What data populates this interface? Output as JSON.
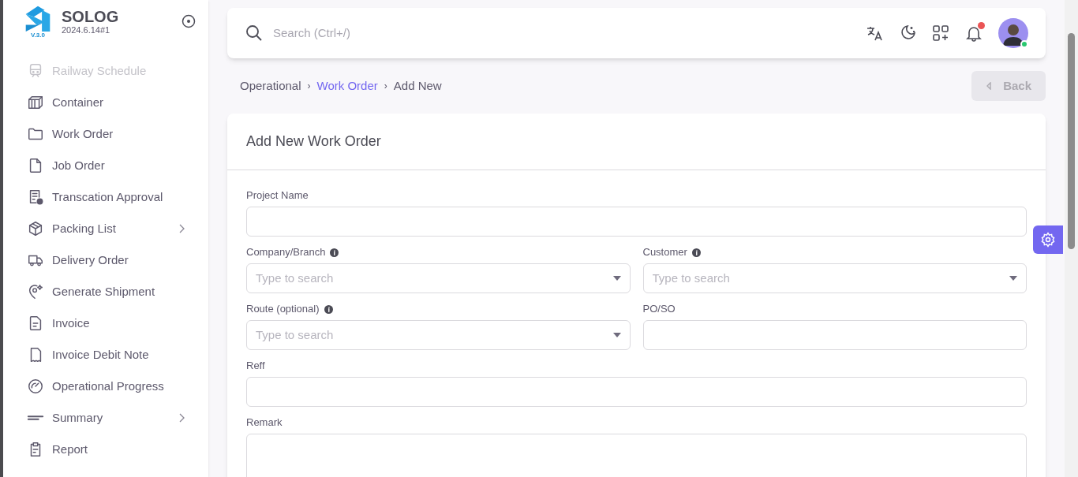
{
  "brand": {
    "name": "SOLOG",
    "version": "2024.6.14#1",
    "logo_caption": "V.3.0"
  },
  "sidebar": {
    "items": [
      {
        "label": "Railway Schedule",
        "faded": true,
        "has_submenu": false
      },
      {
        "label": "Container",
        "faded": false,
        "has_submenu": false
      },
      {
        "label": "Work Order",
        "faded": false,
        "has_submenu": false
      },
      {
        "label": "Job Order",
        "faded": false,
        "has_submenu": false
      },
      {
        "label": "Transcation Approval",
        "faded": false,
        "has_submenu": false
      },
      {
        "label": "Packing List",
        "faded": false,
        "has_submenu": true
      },
      {
        "label": "Delivery Order",
        "faded": false,
        "has_submenu": false
      },
      {
        "label": "Generate Shipment",
        "faded": false,
        "has_submenu": false
      },
      {
        "label": "Invoice",
        "faded": false,
        "has_submenu": false
      },
      {
        "label": "Invoice Debit Note",
        "faded": false,
        "has_submenu": false
      },
      {
        "label": "Operational Progress",
        "faded": false,
        "has_submenu": false
      },
      {
        "label": "Summary",
        "faded": false,
        "has_submenu": true
      },
      {
        "label": "Report",
        "faded": false,
        "has_submenu": false
      }
    ]
  },
  "topbar": {
    "search": {
      "placeholder": "Search (Ctrl+/)"
    },
    "notifications": {
      "has_unread": true
    },
    "user": {
      "online": true
    }
  },
  "breadcrumb": {
    "items": [
      {
        "label": "Operational",
        "link": false
      },
      {
        "label": "Work Order",
        "link": true
      },
      {
        "label": "Add New",
        "link": false
      }
    ],
    "separators": [
      "›",
      "›"
    ]
  },
  "back_button": {
    "label": "Back",
    "disabled": true
  },
  "form": {
    "title": "Add New Work Order",
    "fields": [
      {
        "kind": "text",
        "label": "Project Name",
        "info": false,
        "wide": true
      },
      {
        "kind": "select",
        "label": "Company/Branch",
        "info": true,
        "wide": false,
        "placeholder": "Type to search"
      },
      {
        "kind": "select",
        "label": "Customer",
        "info": true,
        "wide": false,
        "placeholder": "Type to search"
      },
      {
        "kind": "select",
        "label": "Route (optional)",
        "info": true,
        "wide": false,
        "placeholder": "Type to search"
      },
      {
        "kind": "text",
        "label": "PO/SO",
        "info": false,
        "wide": false
      },
      {
        "kind": "text",
        "label": "Reff",
        "info": false,
        "wide": true
      },
      {
        "kind": "textarea",
        "label": "Remark",
        "info": false,
        "wide": true
      }
    ]
  }
}
